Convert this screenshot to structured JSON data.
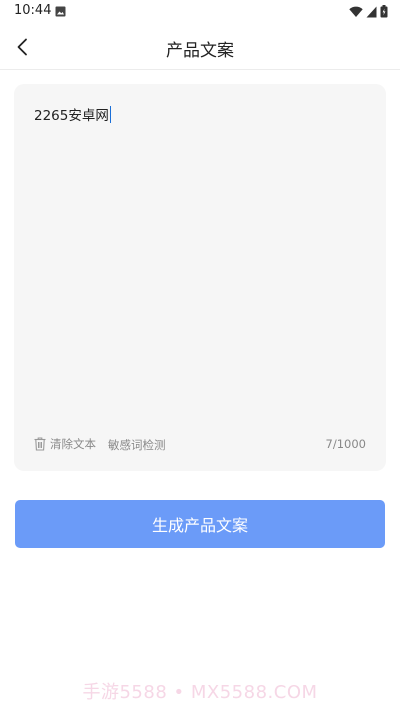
{
  "status_bar": {
    "time": "10:44"
  },
  "header": {
    "title": "产品文案"
  },
  "editor": {
    "value": "2265安卓网",
    "clear_label": "清除文本",
    "check_label": "敏感词检测",
    "counter": "7/1000"
  },
  "actions": {
    "generate_label": "生成产品文案"
  },
  "watermark": "手游5588 • MX5588.COM",
  "colors": {
    "accent": "#6b9bf8",
    "card_bg": "#f6f6f6",
    "caret": "#1a6fd8"
  }
}
